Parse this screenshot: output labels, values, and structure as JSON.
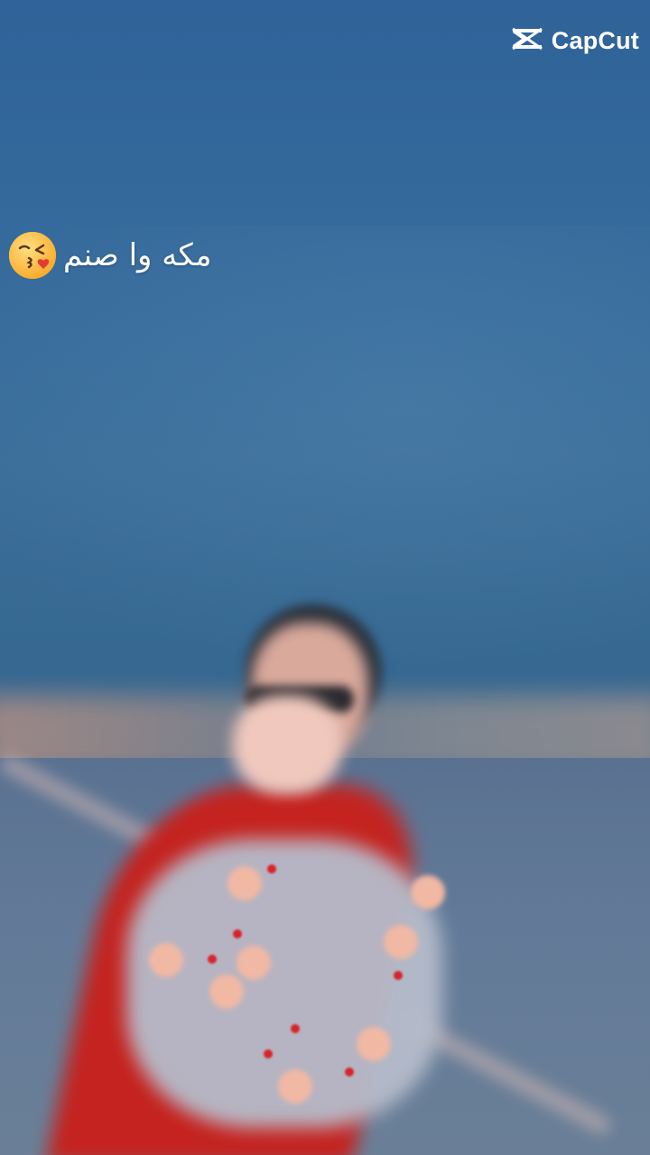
{
  "watermark": {
    "brand": "CapCut",
    "icon": "capcut-logo-icon",
    "color": "#ffffff"
  },
  "caption": {
    "text": "مکه وا صنم",
    "emoji": "face-blowing-a-kiss-icon",
    "color": "#ffffff"
  },
  "scene": {
    "sky_color": "#2f6399",
    "scarf_color": "#c4231f"
  }
}
